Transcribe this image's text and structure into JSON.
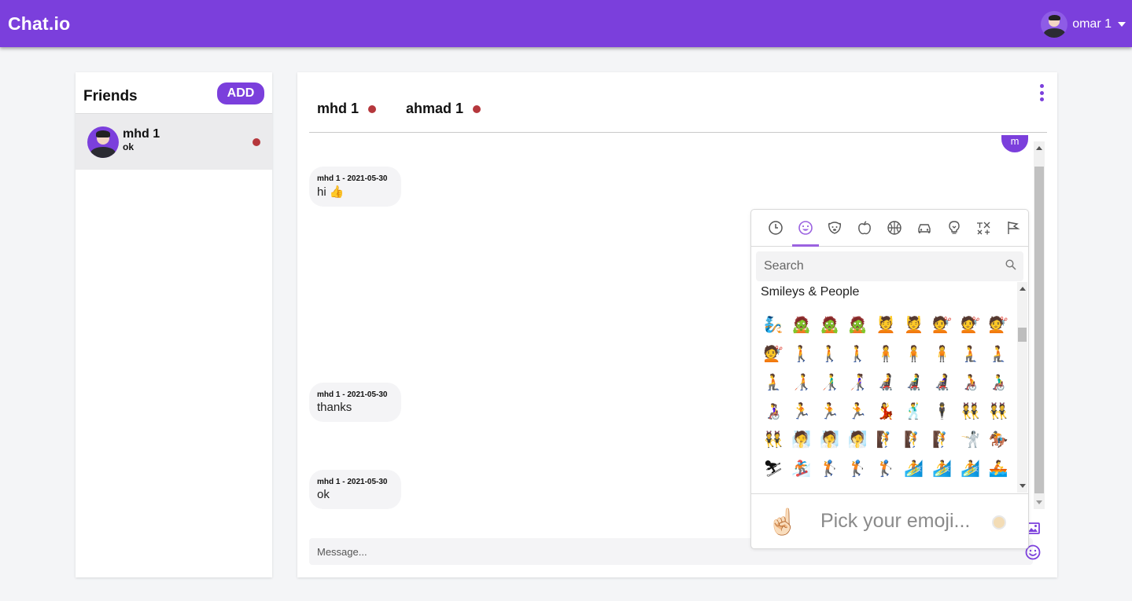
{
  "header": {
    "brand": "Chat.io",
    "user_name": "omar 1"
  },
  "friends": {
    "title": "Friends",
    "add_label": "ADD",
    "items": [
      {
        "name": "mhd 1",
        "status": "ok",
        "online": false
      }
    ]
  },
  "chat": {
    "participants": [
      {
        "name": "mhd 1"
      },
      {
        "name": "ahmad 1"
      }
    ],
    "own_avatar_initial": "m",
    "messages": [
      {
        "meta": "mhd 1 - 2021-05-30",
        "text": "hi 👍"
      },
      {
        "meta": "mhd 1 - 2021-05-30",
        "text": "thanks"
      },
      {
        "meta": "mhd 1 - 2021-05-30",
        "text": "ok"
      }
    ],
    "input_placeholder": "Message..."
  },
  "emoji_picker": {
    "categories": [
      "recent",
      "smileys-people",
      "animals-nature",
      "food-drink",
      "activity",
      "travel-places",
      "objects",
      "symbols",
      "flags"
    ],
    "active_category": "smileys-people",
    "search_placeholder": "Search",
    "category_label": "Smileys & People",
    "emojis": [
      "🧞",
      "🧟",
      "🧟",
      "🧟",
      "💆",
      "💆",
      "💇",
      "💇",
      "💇",
      "💇",
      "🚶",
      "🚶",
      "🚶",
      "🧍",
      "🧍",
      "🧍",
      "🧎",
      "🧎",
      "🧎",
      "🧑‍🦯",
      "👨‍🦯",
      "👩‍🦯",
      "🧑‍🦼",
      "👨‍🦼",
      "👩‍🦼",
      "🧑‍🦽",
      "👨‍🦽",
      "👩‍🦽",
      "🏃",
      "🏃",
      "🏃",
      "💃",
      "🕺",
      "🕴",
      "👯",
      "👯",
      "👯",
      "🧖",
      "🧖",
      "🧖",
      "🧗",
      "🧗",
      "🧗",
      "🤺",
      "🏇",
      "⛷",
      "🏂",
      "🏌",
      "🏌",
      "🏌",
      "🏄",
      "🏄",
      "🏄",
      "🚣"
    ],
    "preview_emoji": "☝🏻",
    "preview_text": "Pick your emoji...",
    "skin_tone_color": "#f3dcb5"
  },
  "colors": {
    "accent": "#7b3fdc",
    "offline": "#b5373c"
  }
}
